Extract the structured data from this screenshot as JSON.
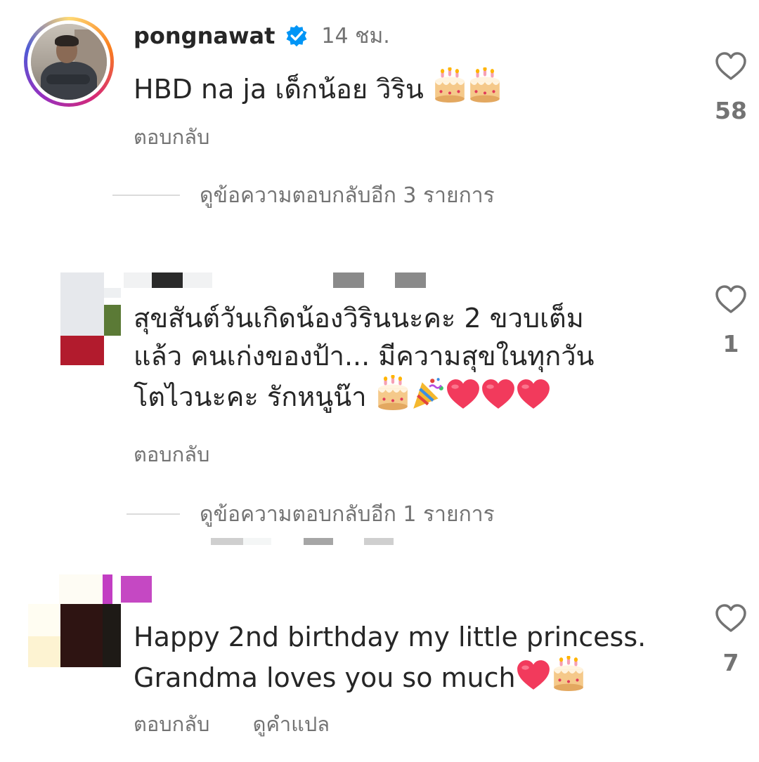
{
  "comments": [
    {
      "username": "pongnawat",
      "verified": true,
      "time": "14 ชม.",
      "lines": [
        "HBD na ja เด็กน้อย วิริน"
      ],
      "reply_label": "ตอบกลับ",
      "likes": "58",
      "view_replies": {
        "prefix": "ดูข้อความตอบกลับอีก",
        "count": "3",
        "suffix": "รายการ"
      }
    },
    {
      "lines": [
        "สุขสันต์วันเกิดน้องวิรินนะคะ 2 ขวบเต็ม",
        "แล้ว  คนเก่งของป้า... มีความสุขในทุกวัน",
        "โตไวนะคะ  รักหนูน๊า"
      ],
      "reply_label": "ตอบกลับ",
      "likes": "1",
      "view_replies": {
        "prefix": "ดูข้อความตอบกลับอีก",
        "count": "1",
        "suffix": "รายการ"
      }
    },
    {
      "lines": [
        "Happy 2nd birthday my little princess.",
        "Grandma loves you so much"
      ],
      "reply_label": "ตอบกลับ",
      "translate_label": "ดูคำแปล",
      "likes": "7"
    }
  ],
  "icons": {
    "like": "heart-outline-icon",
    "verified": "verified-badge-icon",
    "cake": "birthday-cake-emoji",
    "party": "party-popper-emoji",
    "heart": "red-heart-emoji"
  },
  "colors": {
    "text": "#262626",
    "secondary": "#737373",
    "verified": "#0095f6",
    "divider": "#dbdbdb",
    "heart_emoji": "#f23a5c"
  }
}
